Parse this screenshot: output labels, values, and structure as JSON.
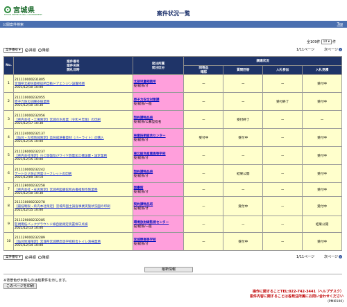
{
  "header": {
    "logo_text": "宮城県",
    "logo_sub": "MIYAGI PREFECTURAL GOVERNMENT",
    "title": "案件状況一覧"
  },
  "navbar": {
    "left": "公開案件検索",
    "right": "Top"
  },
  "count": {
    "prefix": "全109件",
    "per_page": "10",
    "suffix": "件"
  },
  "controls": {
    "sort_select": "案件番号",
    "asc": "昇順",
    "desc": "降順",
    "page": "1/11ページ",
    "next": "次ページ"
  },
  "table": {
    "headers": {
      "no": "No.",
      "case": "案件番号\n案件名称\n開札日時",
      "dept": "発注所属\n発注区分",
      "status": "調達状況",
      "equiv": "同等品\n確認",
      "qa": "質問回答",
      "join": "入札参加",
      "review": "入札見積"
    },
    "rows": [
      {
        "no": "1",
        "id": "211110000231805",
        "name": "宮城県北部児童相談所自動ドアエンジン設置修繕",
        "date": "2021/12/10 10:00",
        "dept": "北部児童相談所",
        "kind": "役/総係/オ",
        "equiv": "ー",
        "qa": "ー",
        "join": "ー",
        "review": "受付中"
      },
      {
        "no": "2",
        "id": "211110000232055",
        "name": "原子力防災訓練支援業務",
        "date": "2021/12/10 10:30",
        "dept": "原子力安全対策課",
        "kind": "役/総係/一般",
        "equiv": "ー",
        "qa": "ー",
        "join": "受付終了",
        "review": "受付中"
      },
      {
        "no": "3",
        "id": "211110000232056",
        "name": "【県内本社・工場限定】宮城の水産業（令和４年版）の印刷",
        "date": "2021/12/17 10:30",
        "dept": "契約課物品班",
        "kind": "役/総係/公募型指名",
        "equiv": "ー",
        "qa": "受付終了",
        "join": "ー",
        "review": "ー"
      },
      {
        "no": "4",
        "id": "211124000232137",
        "name": "【仙台・大崎地域限定】高背成培養資材（バーライト）の購入",
        "date": "2021/12/15 10:00",
        "dept": "林業技術総合センター",
        "kind": "役/総係/オ",
        "equiv": "受付中",
        "qa": "受付中",
        "join": "ー",
        "review": "受付中"
      },
      {
        "no": "5",
        "id": "211126000232237",
        "name": "【県内本社限定】ＮＣ旋盤及びワイヤ放電加工機設置・設定業務",
        "date": "2021/12/15 10:00",
        "dept": "東北総合産業高等学校",
        "kind": "役/総係/オ",
        "equiv": "ー",
        "qa": "ー",
        "join": "ー",
        "review": "受付中"
      },
      {
        "no": "6",
        "id": "211110000232242",
        "name": "デートＤＶ防止啓発リーフレットの印刷",
        "date": "2021/12/09 10:10",
        "dept": "契約課物品班",
        "kind": "役/総係/オ",
        "equiv": "ー",
        "qa": "結果公開",
        "join": "ー",
        "review": "受付中"
      },
      {
        "no": "7",
        "id": "211128000232258",
        "name": "【県内本社・支店限定】宮城県図書館和古書複製作製業務",
        "date": "2021/12/10 10:30",
        "dept": "図書館",
        "kind": "役/総係/オ",
        "equiv": "ー",
        "qa": "ー",
        "join": "ー",
        "review": "受付中"
      },
      {
        "no": "8",
        "id": "211110000232278",
        "name": "【最低制限・県内本社限定】宮城県国土調査事業実施状況図の印刷",
        "date": "2021/12/15 10:00",
        "dept": "契約課物品班",
        "kind": "役/総係/オ",
        "equiv": "ー",
        "qa": "受付中",
        "join": "ー",
        "review": "受付中"
      },
      {
        "no": "9",
        "id": "211129000232285",
        "name": "監視用低バックグラウンド線自動測定装置保守点検",
        "date": "2021/12/13 10:00",
        "dept": "環境放射線監視センター",
        "kind": "役/総係/一般",
        "equiv": "ー",
        "qa": "ー",
        "join": "ー",
        "review": "結果公開"
      },
      {
        "no": "10",
        "id": "211129000232289",
        "name": "【仙台地域限定】宮城県宮城野高等学校校舎トイレ清掃業務",
        "date": "2021/12/14 10:00",
        "dept": "宮城野高等学校",
        "kind": "役/総係/オ",
        "equiv": "ー",
        "qa": "受付中",
        "join": "ー",
        "review": "受付中"
      }
    ]
  },
  "footer": {
    "latest": "最新情報",
    "note": "※背景色が水色ものは結果件を示します。",
    "print": "このページを印刷",
    "contact1": "操作に関することTEL:022-742-3441（ヘルプデスク）",
    "contact2": "案件内容に関することは各発注所属にお問い合わせください",
    "version": "(PMI0100)"
  }
}
